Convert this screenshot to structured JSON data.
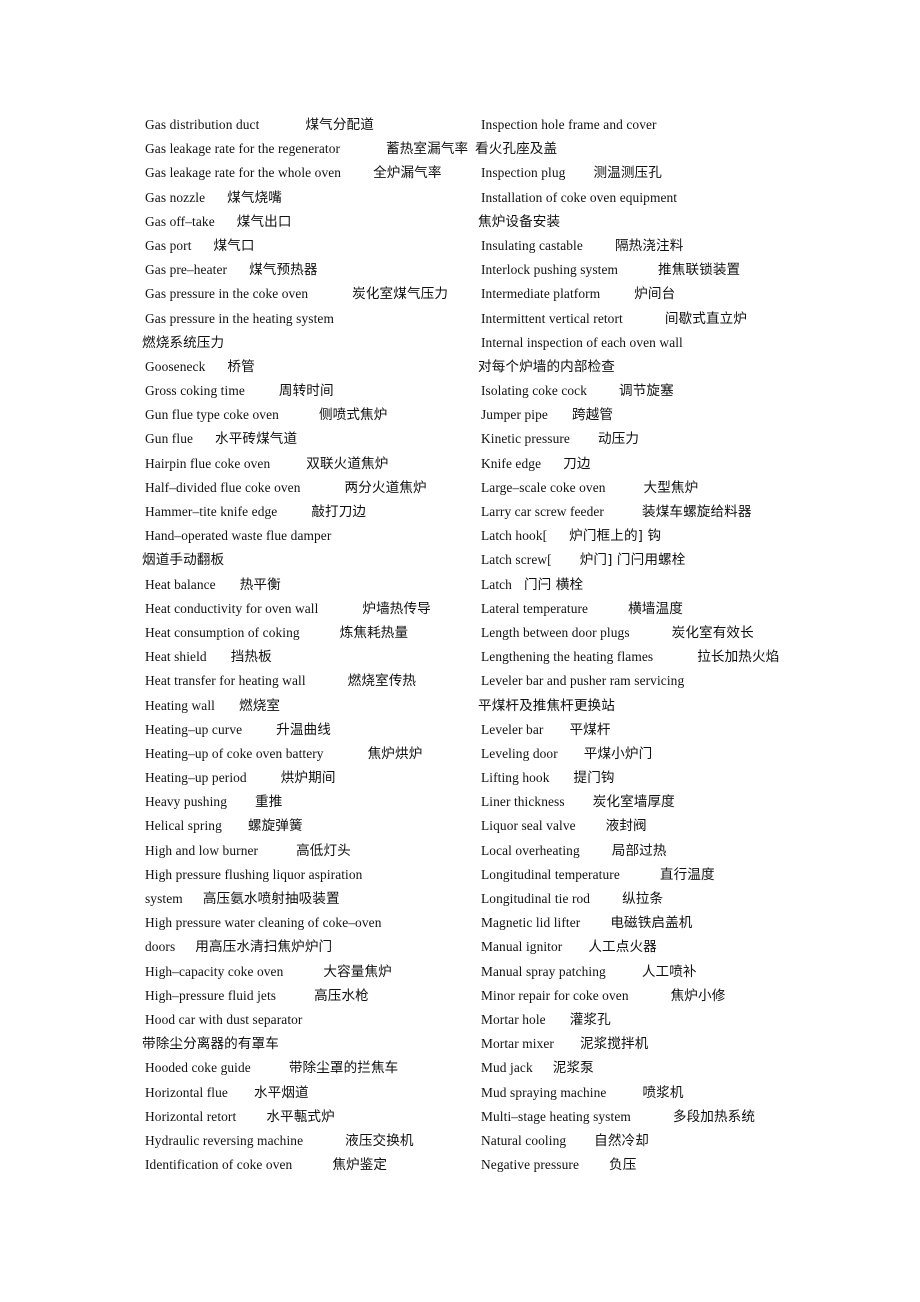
{
  "document": {
    "title": "Coke Oven Terminology Glossary (English–Chinese)",
    "page_background": "#ffffff",
    "text_color": "#111111"
  },
  "columns": {
    "left": {
      "name": "left-glossary-column",
      "entries": [
        {
          "en": "Gas distribution duct",
          "gap": 46,
          "zh": "煤气分配道"
        },
        {
          "en": "Gas leakage rate for the regenerator",
          "gap": 46,
          "zh": "蓄热室漏气率"
        },
        {
          "en": "Gas leakage rate for the whole oven",
          "gap": 32,
          "zh": "全炉漏气率"
        },
        {
          "en": "Gas nozzle",
          "gap": 22,
          "zh": "煤气烧嘴"
        },
        {
          "en": "Gas off–take",
          "gap": 22,
          "zh": "煤气出口"
        },
        {
          "en": "Gas port",
          "gap": 22,
          "zh": "煤气口"
        },
        {
          "en": "Gas pre–heater",
          "gap": 22,
          "zh": "煤气预热器"
        },
        {
          "en": "Gas pressure in the coke oven",
          "gap": 44,
          "zh": "炭化室煤气压力"
        },
        {
          "en": "Gas pressure in the heating system",
          "gap": 0,
          "zh": ""
        },
        {
          "en": "",
          "gap": 0,
          "zh": "燃烧系统压力",
          "cont": true
        },
        {
          "en": "Gooseneck",
          "gap": 22,
          "zh": "桥管"
        },
        {
          "en": "Gross coking time",
          "gap": 34,
          "zh": "周转时间"
        },
        {
          "en": "Gun flue type coke oven",
          "gap": 40,
          "zh": "侧喷式焦炉"
        },
        {
          "en": "Gun flue",
          "gap": 22,
          "zh": "水平砖煤气道"
        },
        {
          "en": "Hairpin flue coke oven",
          "gap": 36,
          "zh": "双联火道焦炉"
        },
        {
          "en": "Half–divided flue coke oven",
          "gap": 44,
          "zh": "两分火道焦炉"
        },
        {
          "en": "Hammer–tite knife edge",
          "gap": 34,
          "zh": "敲打刀边"
        },
        {
          "en": "Hand–operated waste flue damper",
          "gap": 0,
          "zh": ""
        },
        {
          "en": "",
          "gap": 0,
          "zh": "烟道手动翻板",
          "cont": true
        },
        {
          "en": "Heat balance",
          "gap": 24,
          "zh": "热平衡"
        },
        {
          "en": "Heat conductivity for oven wall",
          "gap": 44,
          "zh": "炉墙热传导"
        },
        {
          "en": "Heat consumption of coking",
          "gap": 40,
          "zh": "炼焦耗热量"
        },
        {
          "en": "Heat shield",
          "gap": 24,
          "zh": "挡热板"
        },
        {
          "en": "Heat transfer for heating wall",
          "gap": 42,
          "zh": "燃烧室传热"
        },
        {
          "en": "Heating wall",
          "gap": 24,
          "zh": "燃烧室"
        },
        {
          "en": "Heating–up curve",
          "gap": 34,
          "zh": "升温曲线"
        },
        {
          "en": "Heating–up of coke oven battery",
          "gap": 44,
          "zh": "焦炉烘炉"
        },
        {
          "en": "Heating–up period",
          "gap": 34,
          "zh": "烘炉期间"
        },
        {
          "en": "Heavy pushing",
          "gap": 28,
          "zh": "重推"
        },
        {
          "en": "Helical spring",
          "gap": 26,
          "zh": "螺旋弹簧"
        },
        {
          "en": "High and low burner",
          "gap": 38,
          "zh": "高低灯头"
        },
        {
          "en": "High pressure flushing liquor aspiration",
          "gap": 0,
          "zh": ""
        },
        {
          "en": "system",
          "gap": 20,
          "zh": "高压氨水喷射抽吸装置"
        },
        {
          "en": "High pressure water cleaning of coke–oven",
          "gap": 0,
          "zh": ""
        },
        {
          "en": "doors",
          "gap": 20,
          "zh": "用高压水清扫焦炉炉门"
        },
        {
          "en": "High–capacity coke oven",
          "gap": 40,
          "zh": "大容量焦炉"
        },
        {
          "en": "High–pressure fluid jets",
          "gap": 38,
          "zh": "高压水枪"
        },
        {
          "en": "Hood car with dust separator",
          "gap": 0,
          "zh": ""
        },
        {
          "en": "",
          "gap": 0,
          "zh": "带除尘分离器的有罩车",
          "cont": true
        },
        {
          "en": "Hooded coke guide",
          "gap": 38,
          "zh": "带除尘罩的拦焦车"
        },
        {
          "en": "Horizontal flue",
          "gap": 26,
          "zh": "水平烟道"
        },
        {
          "en": "Horizontal retort",
          "gap": 30,
          "zh": "水平甎式炉"
        },
        {
          "en": "Hydraulic reversing machine",
          "gap": 42,
          "zh": "液压交换机"
        },
        {
          "en": "Identification of coke oven",
          "gap": 40,
          "zh": "焦炉鉴定"
        }
      ]
    },
    "right": {
      "name": "right-glossary-column",
      "entries": [
        {
          "en": "Inspection hole frame and cover",
          "gap": 0,
          "zh": ""
        },
        {
          "en": "",
          "gap": 0,
          "zh": "看火孔座及盖",
          "cont": true,
          "overlap": true
        },
        {
          "en": "Inspection plug",
          "gap": 28,
          "zh": "测温测压孔"
        },
        {
          "en": "Installation of coke oven equipment",
          "gap": 0,
          "zh": ""
        },
        {
          "en": "",
          "gap": 0,
          "zh": "焦炉设备安装",
          "cont": true
        },
        {
          "en": "Insulating castable",
          "gap": 32,
          "zh": "隔热浇注料"
        },
        {
          "en": "Interlock pushing system",
          "gap": 40,
          "zh": "推焦联锁装置"
        },
        {
          "en": "Intermediate platform",
          "gap": 34,
          "zh": "炉间台"
        },
        {
          "en": "Intermittent vertical retort",
          "gap": 42,
          "zh": "间歇式直立炉"
        },
        {
          "en": "Internal inspection of each oven wall",
          "gap": 0,
          "zh": ""
        },
        {
          "en": "",
          "gap": 0,
          "zh": "对每个炉墙的内部检查",
          "cont": true
        },
        {
          "en": "Isolating coke cock",
          "gap": 32,
          "zh": "调节旋塞"
        },
        {
          "en": "Jumper pipe",
          "gap": 24,
          "zh": "跨越管"
        },
        {
          "en": "Kinetic pressure",
          "gap": 28,
          "zh": "动压力"
        },
        {
          "en": "Knife edge",
          "gap": 22,
          "zh": "刀边"
        },
        {
          "en": "Large–scale coke oven",
          "gap": 38,
          "zh": "大型焦炉"
        },
        {
          "en": "Larry car screw feeder",
          "gap": 38,
          "zh": "装煤车螺旋给料器"
        },
        {
          "en": "Latch hook[",
          "gap": 22,
          "zh": "炉门框上的] 钩"
        },
        {
          "en": "Latch screw[",
          "gap": 28,
          "zh": "炉门] 门闩用螺栓"
        },
        {
          "en": "Latch",
          "gap": 12,
          "zh": "门闩  横栓"
        },
        {
          "en": "Lateral temperature",
          "gap": 40,
          "zh": "横墙温度"
        },
        {
          "en": "Length between door plugs",
          "gap": 42,
          "zh": "炭化室有效长"
        },
        {
          "en": "Lengthening the heating flames",
          "gap": 44,
          "zh": "拉长加热火焰"
        },
        {
          "en": "Leveler bar and pusher ram servicing",
          "gap": 0,
          "zh": ""
        },
        {
          "en": "",
          "gap": 0,
          "zh": "平煤杆及推焦杆更换站",
          "cont": true
        },
        {
          "en": "Leveler bar",
          "gap": 26,
          "zh": "平煤杆"
        },
        {
          "en": "Leveling door",
          "gap": 26,
          "zh": "平煤小炉门"
        },
        {
          "en": "Lifting hook",
          "gap": 24,
          "zh": "提门钩"
        },
        {
          "en": "Liner thickness",
          "gap": 28,
          "zh": "炭化室墙厚度"
        },
        {
          "en": "Liquor seal valve",
          "gap": 30,
          "zh": "液封阀"
        },
        {
          "en": "Local overheating",
          "gap": 32,
          "zh": "局部过热"
        },
        {
          "en": "Longitudinal temperature",
          "gap": 40,
          "zh": "直行温度"
        },
        {
          "en": "Longitudinal tie rod",
          "gap": 32,
          "zh": "纵拉条"
        },
        {
          "en": "Magnetic lid lifter",
          "gap": 30,
          "zh": "电磁铁启盖机"
        },
        {
          "en": "Manual ignitor",
          "gap": 26,
          "zh": "人工点火器"
        },
        {
          "en": "Manual spray patching",
          "gap": 36,
          "zh": "人工喷补"
        },
        {
          "en": "Minor repair for coke oven",
          "gap": 42,
          "zh": "焦炉小修"
        },
        {
          "en": "Mortar hole",
          "gap": 24,
          "zh": "灌浆孔"
        },
        {
          "en": "Mortar mixer",
          "gap": 26,
          "zh": "泥浆搅拌机"
        },
        {
          "en": "Mud jack",
          "gap": 20,
          "zh": "泥浆泵"
        },
        {
          "en": "Mud spraying machine",
          "gap": 36,
          "zh": "喷浆机"
        },
        {
          "en": "Multi–stage heating system",
          "gap": 42,
          "zh": "多段加热系统"
        },
        {
          "en": "Natural cooling",
          "gap": 28,
          "zh": "自然冷却"
        },
        {
          "en": "Negative pressure",
          "gap": 30,
          "zh": "负压"
        }
      ]
    }
  }
}
